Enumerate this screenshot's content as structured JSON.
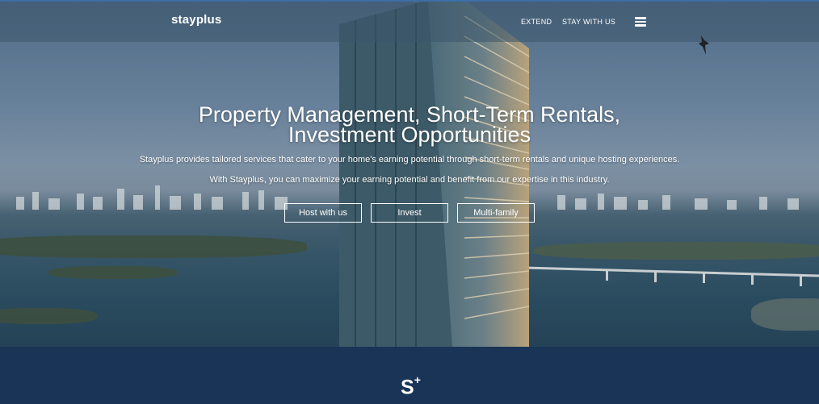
{
  "header": {
    "logo_text": "stayplus",
    "nav": [
      {
        "label": "EXTEND"
      },
      {
        "label": "STAY WITH US"
      }
    ]
  },
  "hero": {
    "title_line1": "Property Management, Short-Term Rentals,",
    "title_line2": "Investment Opportunities",
    "subtitle1": "Stayplus provides tailored services that cater to your home's earning potential through short-term rentals and unique hosting experiences.",
    "subtitle2": "With Stayplus, you can maximize your earning potential and benefit from our expertise in this industry.",
    "buttons": [
      {
        "label": "Host with us"
      },
      {
        "label": "Invest"
      },
      {
        "label": "Multi-family"
      }
    ]
  },
  "footer": {
    "mark": "S",
    "mark_sup": "+"
  },
  "colors": {
    "footer_bg": "#1a3457",
    "topbar_accent": "#3b6fa8"
  }
}
